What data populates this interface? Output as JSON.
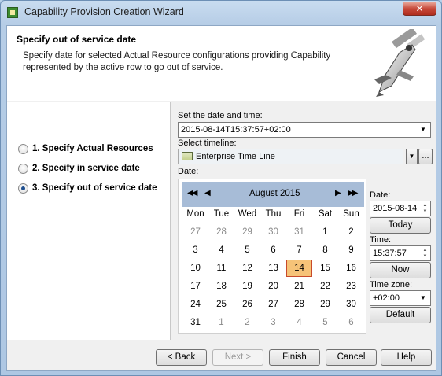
{
  "window": {
    "title": "Capability Provision Creation Wizard",
    "close_label": "✕"
  },
  "banner": {
    "title": "Specify out of service date",
    "description": "Specify date for selected Actual Resource configurations providing Capability represented by the active row to go out of service."
  },
  "steps": [
    {
      "label": "1. Specify Actual Resources",
      "selected": false
    },
    {
      "label": "2. Specify in service date",
      "selected": false
    },
    {
      "label": "3. Specify out of service date",
      "selected": true
    }
  ],
  "form": {
    "datetime_label": "Set the date and time:",
    "datetime_value": "2015-08-14T15:37:57+02:00",
    "timeline_label": "Select timeline:",
    "timeline_value": "Enterprise Time Line",
    "ellipsis_label": "...",
    "date_label": "Date:"
  },
  "calendar": {
    "month_label": "August  2015",
    "nav_prev_year": "◀◀",
    "nav_prev_month": "◀",
    "nav_next_month": "▶",
    "nav_next_year": "▶▶",
    "weekdays": [
      "Mon",
      "Tue",
      "Wed",
      "Thu",
      "Fri",
      "Sat",
      "Sun"
    ],
    "weeks": [
      [
        "27",
        "28",
        "29",
        "30",
        "31",
        "1",
        "2"
      ],
      [
        "3",
        "4",
        "5",
        "6",
        "7",
        "8",
        "9"
      ],
      [
        "10",
        "11",
        "12",
        "13",
        "14",
        "15",
        "16"
      ],
      [
        "17",
        "18",
        "19",
        "20",
        "21",
        "22",
        "23"
      ],
      [
        "24",
        "25",
        "26",
        "27",
        "28",
        "29",
        "30"
      ],
      [
        "31",
        "1",
        "2",
        "3",
        "4",
        "5",
        "6"
      ]
    ],
    "selected_day": "14"
  },
  "side": {
    "date_label": "Date:",
    "date_value": "2015-08-14",
    "today_label": "Today",
    "time_label": "Time:",
    "time_value": "15:37:57",
    "now_label": "Now",
    "timezone_label": "Time zone:",
    "timezone_value": "+02:00",
    "default_label": "Default"
  },
  "footer": {
    "back_label": "< Back",
    "next_label": "Next >",
    "finish_label": "Finish",
    "cancel_label": "Cancel",
    "help_label": "Help"
  }
}
